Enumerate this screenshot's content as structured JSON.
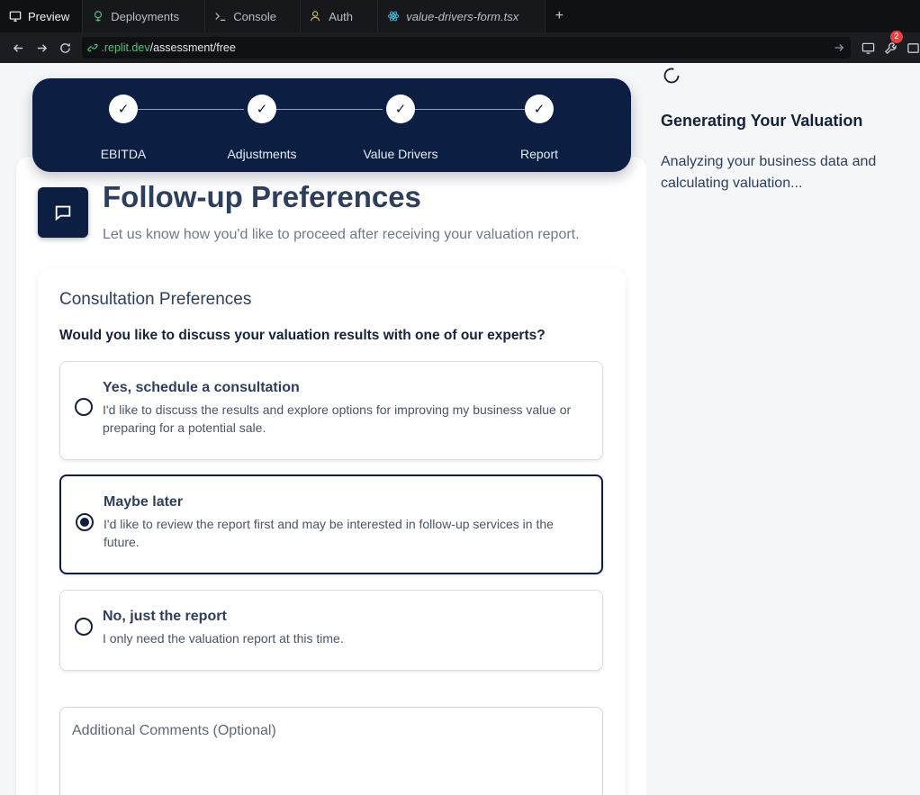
{
  "ide": {
    "tabs": [
      {
        "label": "Preview",
        "icon": "monitor-icon"
      },
      {
        "label": "Deployments",
        "icon": "deploy-icon"
      },
      {
        "label": "Console",
        "icon": "terminal-icon"
      },
      {
        "label": "Auth",
        "icon": "user-icon"
      },
      {
        "label": "value-drivers-form.tsx",
        "icon": "react-icon"
      }
    ],
    "add_tab": "+",
    "url_host": ".replit.dev",
    "url_path": "/assessment/free",
    "notification_count": "2"
  },
  "stepper": {
    "steps": [
      {
        "label": "EBITDA",
        "mark": "✓"
      },
      {
        "label": "Adjustments",
        "mark": "✓"
      },
      {
        "label": "Value Drivers",
        "mark": "✓"
      },
      {
        "label": "Report",
        "mark": "✓"
      }
    ]
  },
  "header": {
    "title": "Follow-up Preferences",
    "subtitle": "Let us know how you'd like to proceed after receiving your valuation report."
  },
  "consultation": {
    "title": "Consultation Preferences",
    "question": "Would you like to discuss your valuation results with one of our experts?",
    "options": [
      {
        "title": "Yes, schedule a consultation",
        "desc": "I'd like to discuss the results and explore options for improving my business value or preparing for a potential sale.",
        "selected": false
      },
      {
        "title": "Maybe later",
        "desc": "I'd like to review the report first and may be interested in follow-up services in the future.",
        "selected": true
      },
      {
        "title": "No, just the report",
        "desc": "I only need the valuation report at this time.",
        "selected": false
      }
    ],
    "comments_placeholder": "Additional Comments (Optional)"
  },
  "side_panel": {
    "title": "Generating Your Valuation",
    "text": "Analyzing your business data and calculating valuation..."
  },
  "colors": {
    "navy": "#0c1f43",
    "url_green": "#4ec279",
    "badge_red": "#e34343"
  }
}
